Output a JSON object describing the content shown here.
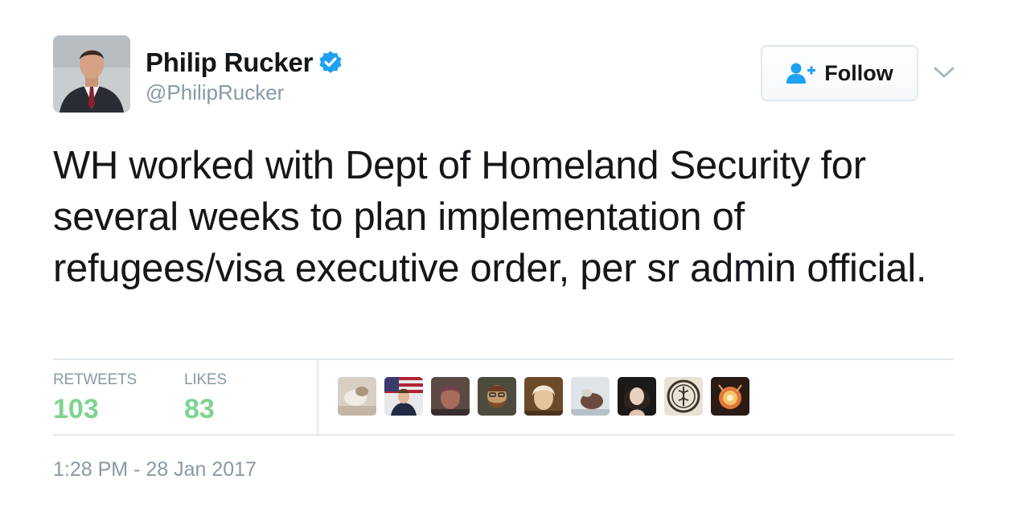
{
  "author": {
    "name": "Philip Rucker",
    "handle": "@PhilipRucker",
    "verified": true,
    "avatar_icon": "profile-photo"
  },
  "follow_button": {
    "label": "Follow",
    "icon": "add-user-icon"
  },
  "menu": {
    "icon": "chevron-down-icon"
  },
  "tweet": {
    "text": "WH worked with Dept of Homeland Security for several weeks to plan implementation of refugees/visa executive order, per sr admin official."
  },
  "stats": {
    "retweets_label": "RETWEETS",
    "retweets_count": "103",
    "likes_label": "LIKES",
    "likes_count": "83"
  },
  "likers": [
    {
      "icon": "liker-avatar-1"
    },
    {
      "icon": "liker-avatar-2"
    },
    {
      "icon": "liker-avatar-3"
    },
    {
      "icon": "liker-avatar-4"
    },
    {
      "icon": "liker-avatar-5"
    },
    {
      "icon": "liker-avatar-6"
    },
    {
      "icon": "liker-avatar-7"
    },
    {
      "icon": "liker-avatar-8"
    },
    {
      "icon": "liker-avatar-9"
    }
  ],
  "timestamp": "1:28 PM - 28 Jan 2017",
  "colors": {
    "verified_blue": "#1da1f2",
    "stat_green": "#7ed48e",
    "muted_gray": "#8899a6",
    "text_dark": "#14171a",
    "divider": "#e1e8ed"
  }
}
